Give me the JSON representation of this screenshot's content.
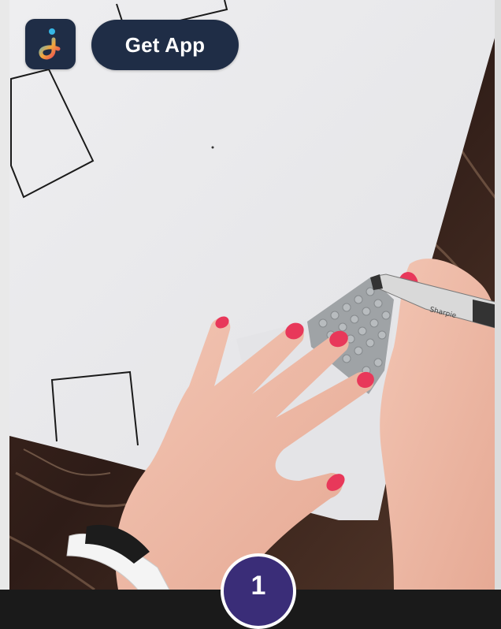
{
  "header": {
    "app_icon": "jumprope-app-icon",
    "get_app_label": "Get App"
  },
  "step_indicator": {
    "label": "1"
  },
  "media": {
    "description_icon": "video-frame-hands-tracing-lego-plate"
  },
  "colors": {
    "button_bg": "#1f2d46",
    "badge_bg": "#3a2d78",
    "paper": "#ebebed",
    "nail_polish": "#e8385a"
  }
}
